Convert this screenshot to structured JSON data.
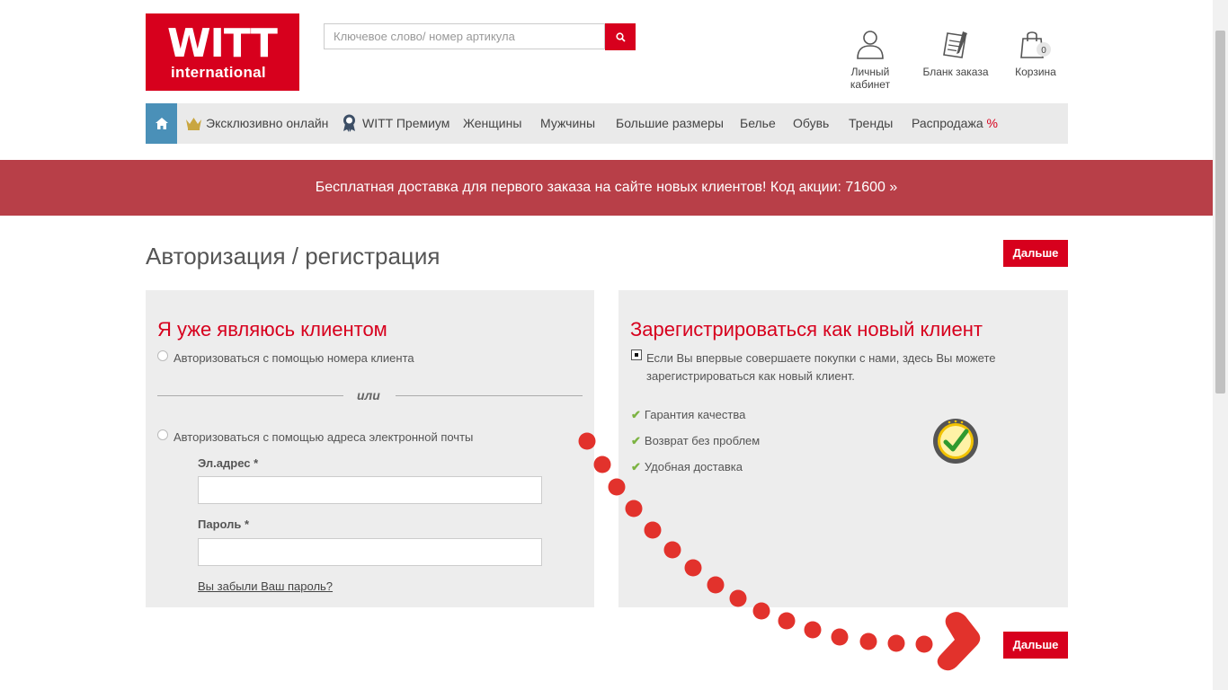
{
  "header": {
    "logo_text_big": "WITT",
    "logo_text_small": "international",
    "search_placeholder": "Ключевое слово/ номер артикула",
    "account_label": "Личный кабинет",
    "order_form_label": "Бланк заказа",
    "cart_label": "Корзина",
    "cart_count": "0"
  },
  "nav": {
    "items": [
      {
        "label": "Эксклюзивно онлайн",
        "icon": "crown-icon"
      },
      {
        "label": "WITT Премиум",
        "icon": "award-icon"
      },
      {
        "label": "Женщины"
      },
      {
        "label": "Мужчины"
      },
      {
        "label": "Большие размеры"
      },
      {
        "label": "Белье"
      },
      {
        "label": "Обувь"
      },
      {
        "label": "Тренды"
      },
      {
        "label": "Распродажа",
        "suffix": "%"
      }
    ]
  },
  "banner": {
    "text": "Бесплатная доставка для первого заказа на сайте новых клиентов! Код акции: 71600 »"
  },
  "page": {
    "title": "Авторизация / регистрация",
    "next_label": "Дальше"
  },
  "existing_client": {
    "heading": "Я уже являюсь клиентом",
    "option_number": "Авторизоваться с помощью номера клиента",
    "or_text": "или",
    "option_email": "Авторизоваться с помощью адреса электронной почты",
    "email_label": "Эл.адрес *",
    "password_label": "Пароль *",
    "forgot_link": "Вы забыли Ваш пароль?"
  },
  "new_client": {
    "heading": "Зарегистрироваться как новый клиент",
    "description_line1": "Если Вы впервые совершаете покупки с нами, здесь Вы можете",
    "description_line2": "зарегистрироваться как новый клиент.",
    "benefits": [
      "Гарантия качества",
      "Возврат без проблем",
      "Удобная доставка"
    ]
  },
  "colors": {
    "brand": "#d7001d",
    "banner": "#b83f48",
    "home_tab": "#4a90b8",
    "panel": "#ededed"
  }
}
